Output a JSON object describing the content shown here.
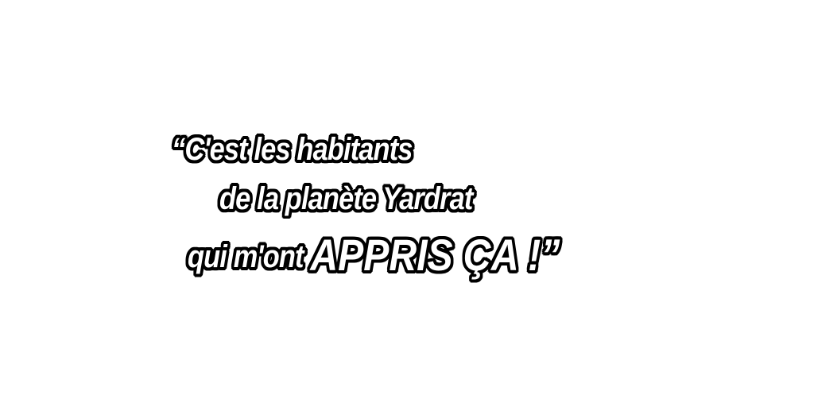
{
  "quote": {
    "line1": "“C'est les habitants",
    "line2": "de la planète Yardrat",
    "line3_lead": "qui m'ont ",
    "line3_emphasis": "APPRIS ÇA !”"
  }
}
